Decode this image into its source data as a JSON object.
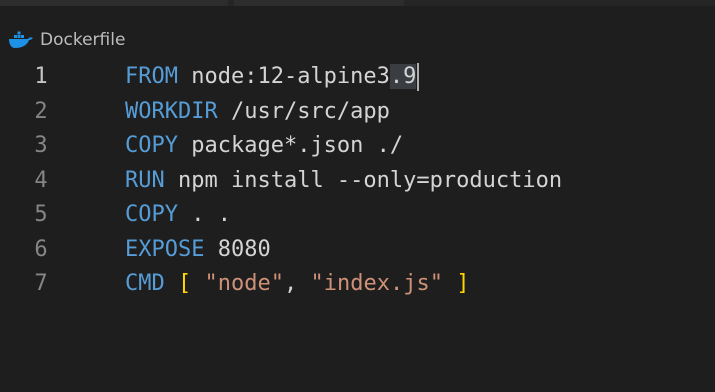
{
  "breadcrumb": {
    "filename": "Dockerfile",
    "icon": "docker-whale-icon"
  },
  "lines": [
    {
      "number": "1",
      "tokens": [
        {
          "t": "FROM",
          "c": "kw"
        },
        {
          "t": " node:12-alpine3",
          "c": ""
        },
        {
          "t": ".9",
          "c": "sel"
        }
      ]
    },
    {
      "number": "2",
      "tokens": [
        {
          "t": "WORKDIR",
          "c": "kw"
        },
        {
          "t": " /usr/src/app",
          "c": ""
        }
      ]
    },
    {
      "number": "3",
      "tokens": [
        {
          "t": "COPY",
          "c": "kw"
        },
        {
          "t": " package*.json ./",
          "c": ""
        }
      ]
    },
    {
      "number": "4",
      "tokens": [
        {
          "t": "RUN",
          "c": "kw"
        },
        {
          "t": " npm install --only=production",
          "c": ""
        }
      ]
    },
    {
      "number": "5",
      "tokens": [
        {
          "t": "COPY",
          "c": "kw"
        },
        {
          "t": " . .",
          "c": ""
        }
      ]
    },
    {
      "number": "6",
      "tokens": [
        {
          "t": "EXPOSE",
          "c": "kw"
        },
        {
          "t": " 8080",
          "c": ""
        }
      ]
    },
    {
      "number": "7",
      "tokens": [
        {
          "t": "CMD",
          "c": "kw"
        },
        {
          "t": " ",
          "c": ""
        },
        {
          "t": "[",
          "c": "brk"
        },
        {
          "t": " ",
          "c": ""
        },
        {
          "t": "\"node\"",
          "c": "str"
        },
        {
          "t": ", ",
          "c": ""
        },
        {
          "t": "\"index.js\"",
          "c": "str"
        },
        {
          "t": " ",
          "c": ""
        },
        {
          "t": "]",
          "c": "brk"
        }
      ]
    }
  ],
  "active_line": 1,
  "colors": {
    "background": "#1e1e1e",
    "keyword": "#569cd6",
    "string": "#ce9178",
    "bracket": "#ffd700",
    "text": "#d4d4d4",
    "line_number": "#858585"
  }
}
